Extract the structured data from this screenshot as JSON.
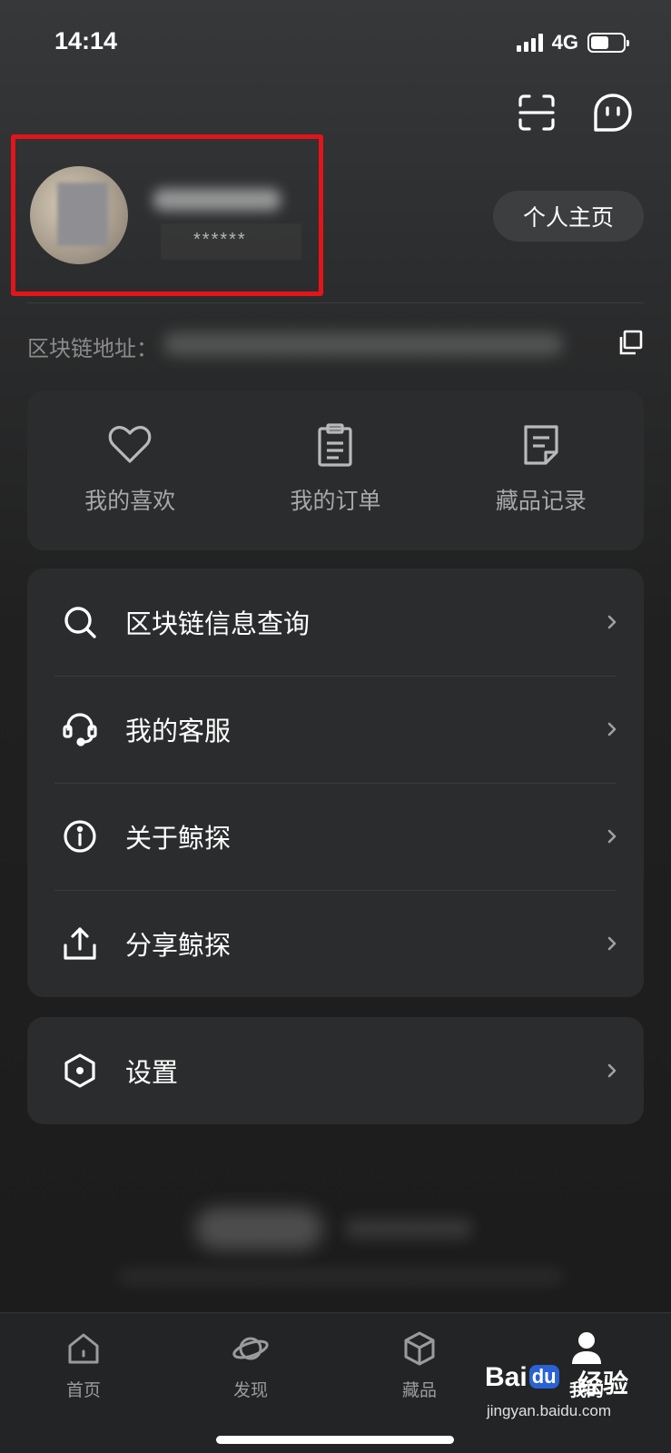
{
  "status_bar": {
    "time": "14:14",
    "network": "4G",
    "battery_level": 0.55
  },
  "header": {
    "icons": [
      "scan-icon",
      "message-icon"
    ]
  },
  "profile": {
    "user_id": "******",
    "homepage_button": "个人主页"
  },
  "chain": {
    "label": "区块链地址：",
    "icon": "copy-icon"
  },
  "quick_actions": [
    {
      "label": "我的喜欢",
      "icon": "heart-icon"
    },
    {
      "label": "我的订单",
      "icon": "clipboard-icon"
    },
    {
      "label": "藏品记录",
      "icon": "document-icon"
    }
  ],
  "menu": [
    {
      "label": "区块链信息查询",
      "icon": "search-icon"
    },
    {
      "label": "我的客服",
      "icon": "headset-icon"
    },
    {
      "label": "关于鲸探",
      "icon": "info-icon"
    },
    {
      "label": "分享鲸探",
      "icon": "share-icon"
    }
  ],
  "settings": {
    "label": "设置",
    "icon": "settings-hexagon-icon"
  },
  "tabbar": [
    {
      "label": "首页",
      "icon": "home-icon",
      "active": false
    },
    {
      "label": "发现",
      "icon": "planet-icon",
      "active": false
    },
    {
      "label": "藏品",
      "icon": "cube-icon",
      "active": false
    },
    {
      "label": "我的",
      "icon": "person-icon",
      "active": true
    }
  ],
  "watermark": {
    "brand": "Bai",
    "brand_suffix": "du",
    "cn": "经验",
    "url": "jingyan.baidu.com"
  },
  "colors": {
    "background": "#202020",
    "card": "#2b2c2d",
    "highlight_border": "#e3141a",
    "muted_text": "#a7a8aa"
  }
}
